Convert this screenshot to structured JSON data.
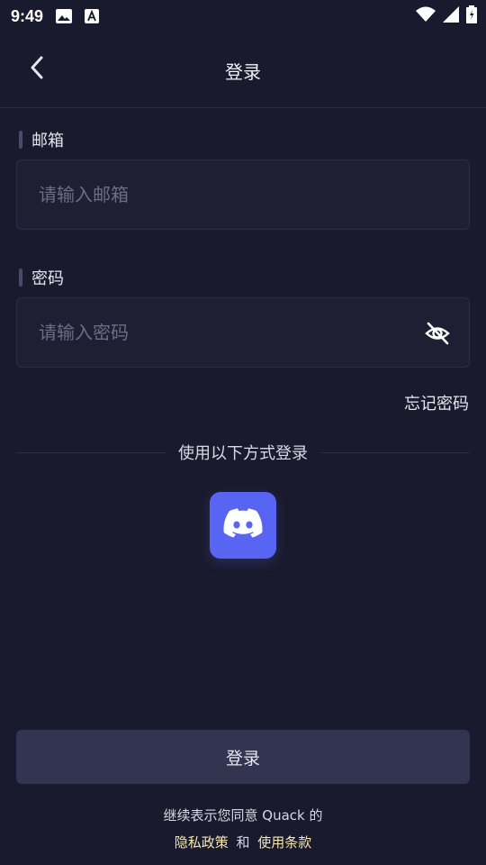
{
  "status_bar": {
    "time": "9:49",
    "icons": [
      "image-icon",
      "font-a-icon",
      "wifi-icon",
      "signal-icon",
      "battery-icon"
    ]
  },
  "header": {
    "title": "登录",
    "back_icon": "chevron-left-icon"
  },
  "email": {
    "label": "邮箱",
    "placeholder": "请输入邮箱",
    "value": ""
  },
  "password": {
    "label": "密码",
    "placeholder": "请输入密码",
    "value": "",
    "toggle_icon": "eye-off-icon"
  },
  "forgot_password": "忘记密码",
  "alt_login": {
    "divider_text": "使用以下方式登录",
    "providers": [
      {
        "name": "discord-icon",
        "color": "#5865F2"
      }
    ]
  },
  "login_button": "登录",
  "agreement": {
    "prefix": "继续表示您同意 Quack 的",
    "privacy_link": "隐私政策",
    "conjunction": "和",
    "terms_link": "使用条款"
  },
  "colors": {
    "background": "#1A1A2E",
    "input_bg": "#1F1F34",
    "button_bg": "#33344F",
    "link": "#F4E7B0",
    "discord": "#5865F2"
  }
}
